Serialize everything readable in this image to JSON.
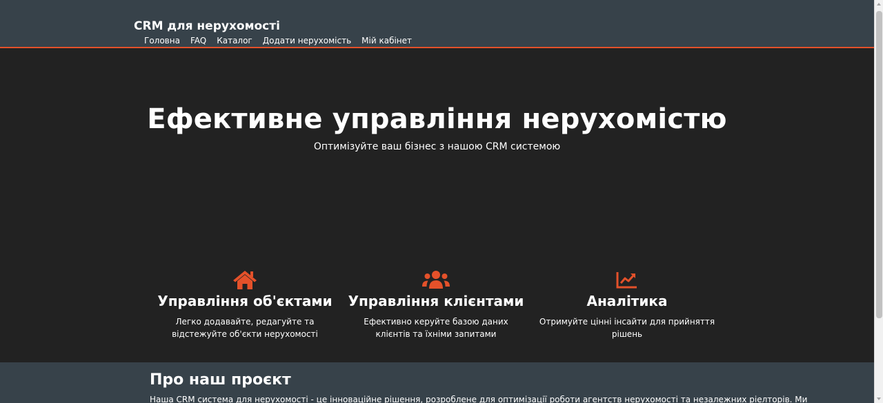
{
  "header": {
    "brand": "CRM для нерухомості",
    "nav": [
      "Головна",
      "FAQ",
      "Каталог",
      "Додати нерухомість",
      "Мій кабінет"
    ]
  },
  "hero": {
    "title": "Ефективне управління нерухомістю",
    "subtitle": "Оптимізуйте ваш бізнес з нашою CRM системою"
  },
  "features": [
    {
      "icon": "home-icon",
      "title": "Управління об'єктами",
      "text": "Легко додавайте, редагуйте та відстежуйте об'єкти нерухомості"
    },
    {
      "icon": "users-icon",
      "title": "Управління клієнтами",
      "text": "Ефективно керуйте базою даних клієнтів та їхніми запитами"
    },
    {
      "icon": "chart-line-icon",
      "title": "Аналітика",
      "text": "Отримуйте цінні інсайти для прийняття рішень"
    }
  ],
  "about": {
    "title": "Про наш проєкт",
    "text": "Наша CRM система для нерухомості - це інноваційне рішення, розроблене для оптимізації роботи агентств нерухомості та незалежних ріелторів. Ми"
  },
  "colors": {
    "header_bg": "#37424a",
    "accent": "#e4512a",
    "page_bg": "#222222",
    "text": "#ffffff"
  }
}
